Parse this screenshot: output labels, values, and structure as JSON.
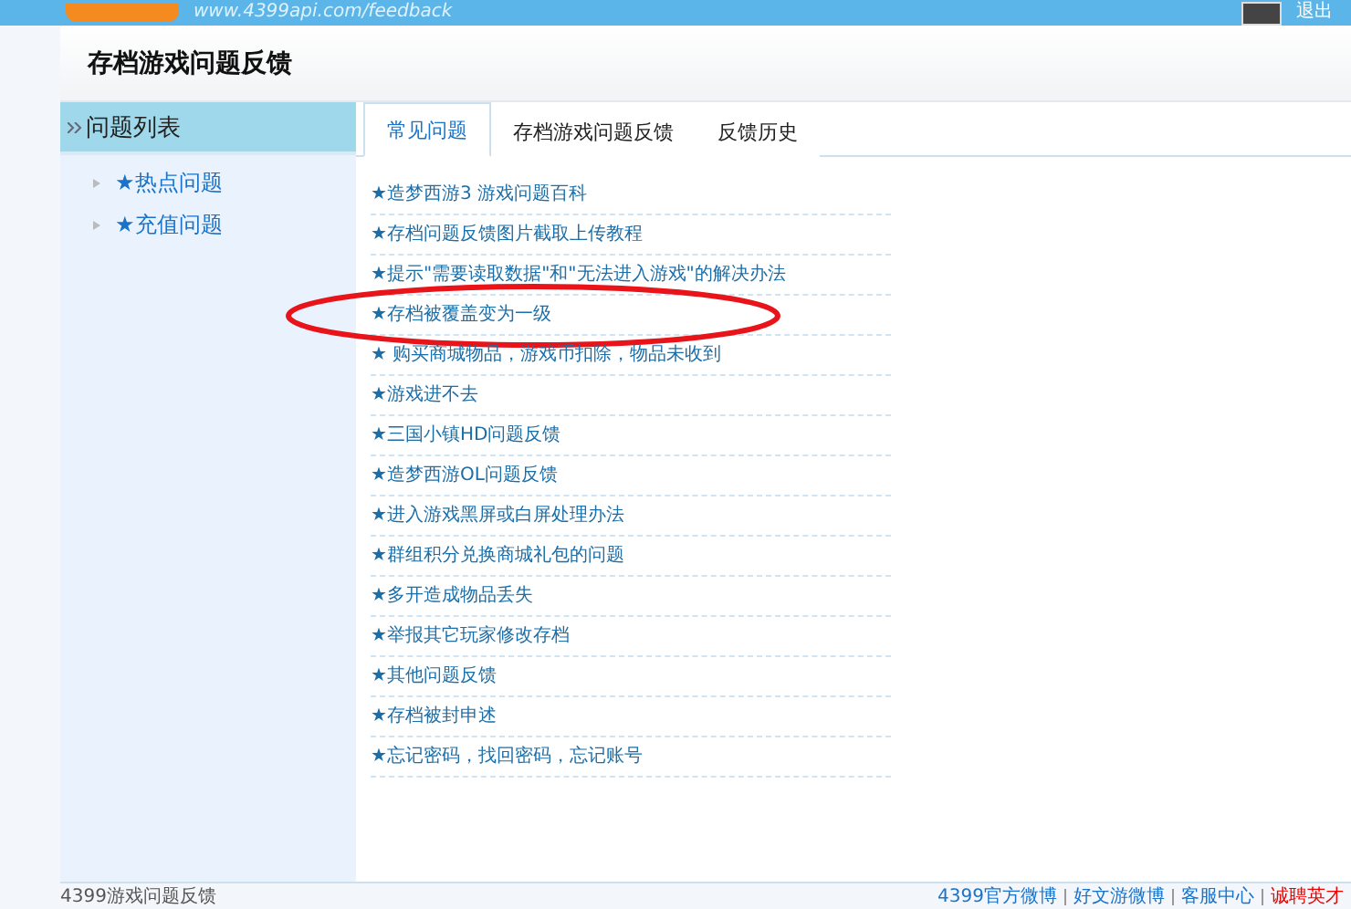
{
  "header": {
    "url": "www.4399api.com/feedback",
    "logout": "退出"
  },
  "page_title": "存档游戏问题反馈",
  "sidebar": {
    "title": "问题列表",
    "items": [
      {
        "label": "★热点问题"
      },
      {
        "label": "★充值问题"
      }
    ]
  },
  "tabs": [
    {
      "label": "常见问题",
      "selected": true
    },
    {
      "label": "存档游戏问题反馈",
      "selected": false
    },
    {
      "label": "反馈历史",
      "selected": false
    }
  ],
  "questions": [
    {
      "label": "★造梦西游3 游戏问题百科",
      "circled": false
    },
    {
      "label": "★存档问题反馈图片截取上传教程",
      "circled": false
    },
    {
      "label": "★提示\"需要读取数据\"和\"无法进入游戏\"的解决办法",
      "circled": false
    },
    {
      "label": "★存档被覆盖变为一级",
      "circled": true
    },
    {
      "label": "★ 购买商城物品，游戏币扣除，物品未收到",
      "circled": false
    },
    {
      "label": "★游戏进不去",
      "circled": false
    },
    {
      "label": "★三国小镇HD问题反馈",
      "circled": false
    },
    {
      "label": "★造梦西游OL问题反馈",
      "circled": false
    },
    {
      "label": "★进入游戏黑屏或白屏处理办法",
      "circled": false
    },
    {
      "label": "★群组积分兑换商城礼包的问题",
      "circled": false
    },
    {
      "label": "★多开造成物品丢失",
      "circled": false
    },
    {
      "label": "★举报其它玩家修改存档",
      "circled": false
    },
    {
      "label": "★其他问题反馈",
      "circled": false
    },
    {
      "label": "★存档被封申述",
      "circled": false
    },
    {
      "label": "★忘记密码，找回密码，忘记账号",
      "circled": false
    }
  ],
  "footer": {
    "text": "4399游戏问题反馈",
    "links": [
      {
        "label": "4399官方微博",
        "kind": "normal"
      },
      {
        "label": "好文游微博",
        "kind": "normal"
      },
      {
        "label": "客服中心",
        "kind": "normal"
      },
      {
        "label": "诚聘英才",
        "kind": "hot"
      }
    ]
  }
}
